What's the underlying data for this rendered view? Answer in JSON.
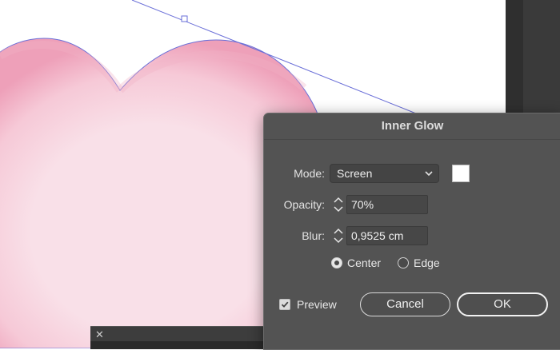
{
  "dialog": {
    "title": "Inner Glow",
    "mode": {
      "label": "Mode:",
      "value": "Screen"
    },
    "swatch_color": "#ffffff",
    "opacity": {
      "label": "Opacity:",
      "value": "70%"
    },
    "blur": {
      "label": "Blur:",
      "value": "0,9525 cm"
    },
    "source": {
      "center_label": "Center",
      "edge_label": "Edge",
      "selected": "Center"
    },
    "preview": {
      "label": "Preview",
      "checked": true
    },
    "cancel_label": "Cancel",
    "ok_label": "OK"
  },
  "bottom_panel": {
    "close_glyph": "✕"
  },
  "colors": {
    "heart_fill": "#f8dce5",
    "heart_glow": "#f2aac0",
    "path_stroke": "#6a6fd8",
    "dialog_bg": "#535353"
  }
}
